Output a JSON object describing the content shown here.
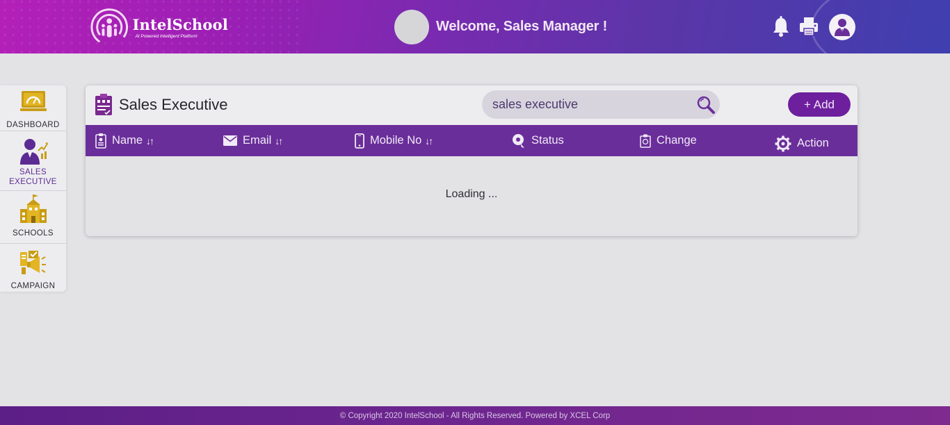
{
  "header": {
    "logo_title": "IntelSchool",
    "logo_subtitle": "AI Powered Intelligent Platform",
    "welcome": "Welcome, Sales Manager !",
    "icons": [
      "bell-icon",
      "printer-icon",
      "user-avatar"
    ]
  },
  "sidebar": {
    "items": [
      {
        "label": "DASHBOARD",
        "icon": "dashboard-icon"
      },
      {
        "label": "SALES",
        "label2": "EXECUTIVE",
        "icon": "sales-executive-icon",
        "active": true
      },
      {
        "label": "SCHOOLS",
        "icon": "school-icon"
      },
      {
        "label": "CAMPAIGN",
        "icon": "campaign-icon"
      }
    ]
  },
  "main": {
    "title": "Sales Executive",
    "search": {
      "value": "sales executive",
      "placeholder": "sales executive"
    },
    "add_label": "+ Add",
    "columns": [
      {
        "label": "Name",
        "sortable": true,
        "icon": "id-card-icon"
      },
      {
        "label": "Email",
        "sortable": true,
        "icon": "envelope-icon"
      },
      {
        "label": "Mobile No",
        "sortable": true,
        "icon": "mobile-icon"
      },
      {
        "label": "Status",
        "sortable": false,
        "icon": "status-icon"
      },
      {
        "label": "Change",
        "sortable": false,
        "icon": "change-icon"
      },
      {
        "label": "Action",
        "sortable": false,
        "icon": "gear-icon"
      }
    ],
    "sort_glyph": "↓↑",
    "loading_text": "Loading ..."
  },
  "footer": {
    "copyright": "© Copyright 2020 IntelSchool - All Rights Reserved. Powered by XCEL Corp"
  },
  "colors": {
    "primary": "#6a2e9a",
    "accent_yellow": "#d4a017",
    "header_start": "#b320b8",
    "header_end": "#3f3fb0"
  }
}
